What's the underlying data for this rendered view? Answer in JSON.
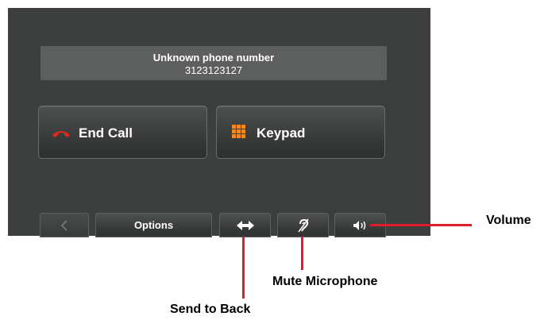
{
  "caller": {
    "name": "Unknown phone number",
    "number": "3123123127"
  },
  "buttons": {
    "end_call": "End Call",
    "keypad": "Keypad"
  },
  "bottom_bar": {
    "options": "Options",
    "back_icon": "chevron-left-icon",
    "send_to_back_icon": "double-arrow-icon",
    "mute_icon": "mute-microphone-icon",
    "volume_icon": "speaker-icon"
  },
  "callouts": {
    "volume": "Volume",
    "mute_microphone": "Mute Microphone",
    "send_to_back": "Send to Back"
  },
  "colors": {
    "screen_background": "#3d3f3e",
    "end_call_icon": "#e8261f",
    "keypad_icon": "#f28a1e",
    "callout_line": "#e01d2a"
  }
}
